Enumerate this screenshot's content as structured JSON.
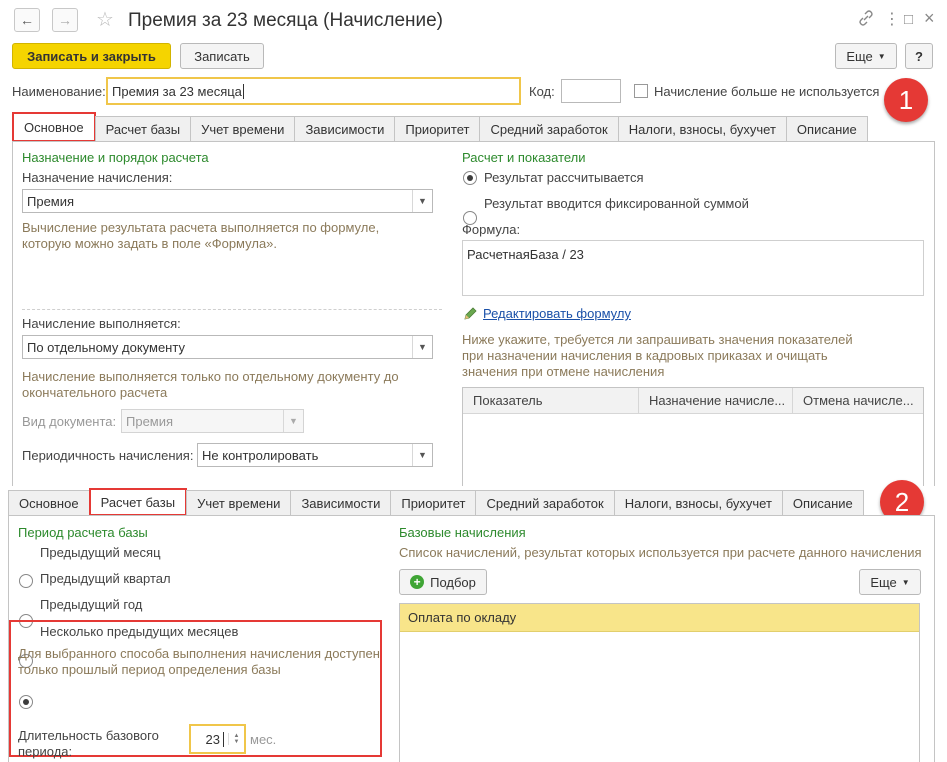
{
  "window": {
    "title": "Премия за 23 месяца (Начисление)",
    "back_icon": "←",
    "forward_icon": "→",
    "star_icon": "☆",
    "link_icon": "🔗",
    "more_icon": "⋮",
    "maximize_icon": "□",
    "close_icon": "×"
  },
  "toolbar": {
    "save_close": "Записать и закрыть",
    "save": "Записать",
    "more": "Еще",
    "help": "?"
  },
  "header": {
    "name_label": "Наименование:",
    "name_value": "Премия за 23 месяца",
    "code_label": "Код:",
    "code_value": "",
    "not_used_label": "Начисление больше не используется"
  },
  "badges": {
    "one": "1",
    "two": "2"
  },
  "tabs": [
    {
      "label": "Основное"
    },
    {
      "label": "Расчет базы"
    },
    {
      "label": "Учет времени"
    },
    {
      "label": "Зависимости"
    },
    {
      "label": "Приоритет"
    },
    {
      "label": "Средний заработок"
    },
    {
      "label": "Налоги, взносы, бухучет"
    },
    {
      "label": "Описание"
    }
  ],
  "main": {
    "purpose_section": "Назначение и порядок расчета",
    "purpose_label": "Назначение начисления:",
    "purpose_value": "Премия",
    "purpose_hint": "Вычисление результата расчета выполняется по формуле, которую можно задать в поле «Формула».",
    "exec_label": "Начисление выполняется:",
    "exec_value": "По отдельному документу",
    "exec_hint": "Начисление выполняется только по отдельному документу до окончательного расчета",
    "doc_type_label": "Вид документа:",
    "doc_type_value": "Премия",
    "periodicity_label": "Периодичность начисления:",
    "periodicity_value": "Не контролировать",
    "calc_section": "Расчет и показатели",
    "radio_calc": "Результат рассчитывается",
    "radio_fixed": "Результат вводится фиксированной суммой",
    "formula_label": "Формула:",
    "formula_value": "РасчетнаяБаза / 23",
    "edit_formula": "Редактировать формулу",
    "indicators_hint": "Ниже укажите, требуется ли запрашивать значения показателей при назначении начисления в кадровых приказах и очищать значения при отмене начисления",
    "table_headers": [
      "Показатель",
      "Назначение начисле...",
      "Отмена начисле..."
    ]
  },
  "base": {
    "period_section": "Период расчета базы",
    "radios": [
      {
        "label": "Предыдущий месяц"
      },
      {
        "label": "Предыдущий квартал"
      },
      {
        "label": "Предыдущий год"
      },
      {
        "label": "Несколько предыдущих месяцев"
      }
    ],
    "period_hint": "Для выбранного способа выполнения начисления доступен только прошлый период определения базы",
    "duration_label": "Длительность базового периода:",
    "duration_value": "23",
    "duration_unit": "мес.",
    "base_section": "Базовые начисления",
    "base_hint": "Список начислений, результат которых используется при расчете данного начисления",
    "pick_button": "Подбор",
    "more_button": "Еще",
    "base_items": [
      "Оплата по окладу"
    ]
  },
  "colors": {
    "accent_yellow": "#f5d400",
    "badge_red": "#e53935",
    "section_green": "#2d8a2d",
    "hint_brown": "#8b7a5a",
    "selected_row": "#f8e58a"
  }
}
